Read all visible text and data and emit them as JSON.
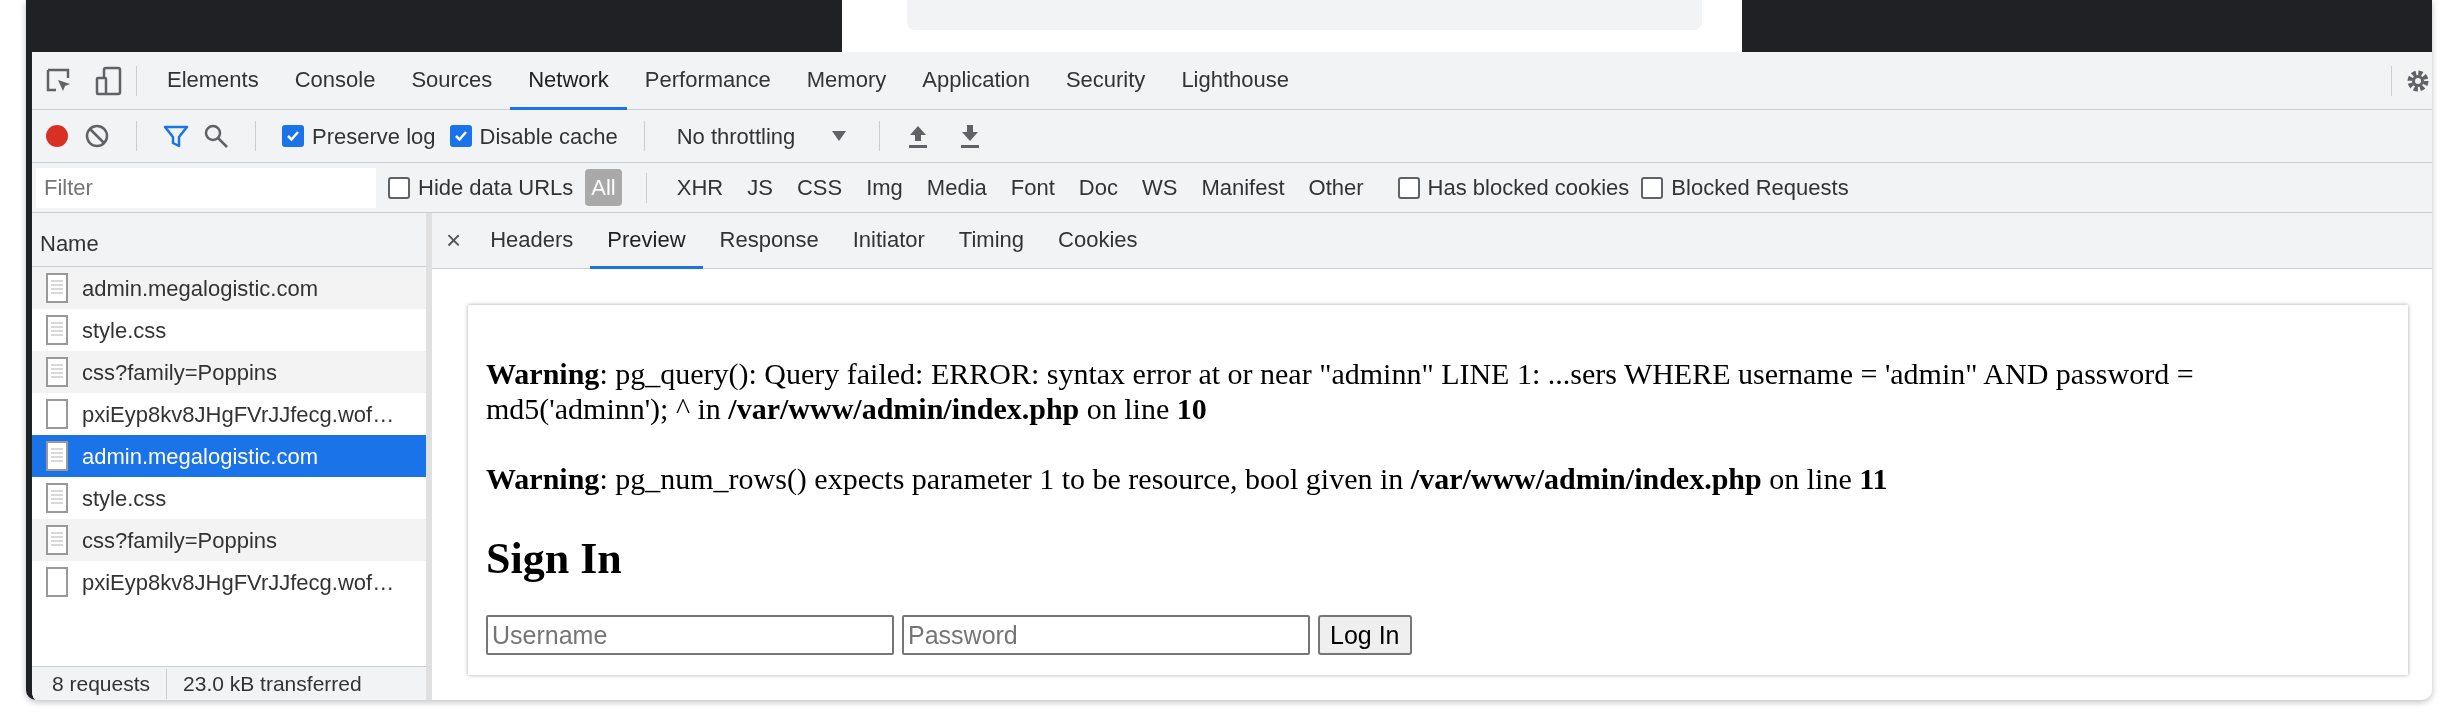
{
  "panel_tabs": [
    {
      "label": "Elements",
      "selected": false
    },
    {
      "label": "Console",
      "selected": false
    },
    {
      "label": "Sources",
      "selected": false
    },
    {
      "label": "Network",
      "selected": true
    },
    {
      "label": "Performance",
      "selected": false
    },
    {
      "label": "Memory",
      "selected": false
    },
    {
      "label": "Application",
      "selected": false
    },
    {
      "label": "Security",
      "selected": false
    },
    {
      "label": "Lighthouse",
      "selected": false
    }
  ],
  "toolbar": {
    "recording": true,
    "checkboxes": [
      {
        "label": "Preserve log",
        "checked": true
      },
      {
        "label": "Disable cache",
        "checked": true
      }
    ],
    "throttling": "No throttling"
  },
  "filter": {
    "placeholder": "Filter",
    "hide_data_urls": {
      "label": "Hide data URLs",
      "checked": false
    },
    "types": [
      {
        "label": "All",
        "selected": true
      },
      {
        "label": "XHR",
        "selected": false
      },
      {
        "label": "JS",
        "selected": false
      },
      {
        "label": "CSS",
        "selected": false
      },
      {
        "label": "Img",
        "selected": false
      },
      {
        "label": "Media",
        "selected": false
      },
      {
        "label": "Font",
        "selected": false
      },
      {
        "label": "Doc",
        "selected": false
      },
      {
        "label": "WS",
        "selected": false
      },
      {
        "label": "Manifest",
        "selected": false
      },
      {
        "label": "Other",
        "selected": false
      }
    ],
    "extra_checkboxes": [
      {
        "label": "Has blocked cookies",
        "checked": false
      },
      {
        "label": "Blocked Requests",
        "checked": false
      }
    ]
  },
  "requests": {
    "header": "Name",
    "items": [
      {
        "name": "admin.megalogistic.com",
        "kind": "document",
        "selected": false
      },
      {
        "name": "style.css",
        "kind": "document",
        "selected": false
      },
      {
        "name": "css?family=Poppins",
        "kind": "document",
        "selected": false
      },
      {
        "name": "pxiEyp8kv8JHgFVrJJfecg.wof…",
        "kind": "blank",
        "selected": false
      },
      {
        "name": "admin.megalogistic.com",
        "kind": "document",
        "selected": true
      },
      {
        "name": "style.css",
        "kind": "document",
        "selected": false
      },
      {
        "name": "css?family=Poppins",
        "kind": "document",
        "selected": false
      },
      {
        "name": "pxiEyp8kv8JHgFVrJJfecg.wof…",
        "kind": "blank",
        "selected": false
      }
    ]
  },
  "status_bar": [
    "8 requests",
    "23.0 kB transferred"
  ],
  "detail": {
    "close": "×",
    "tabs": [
      {
        "label": "Headers",
        "selected": false
      },
      {
        "label": "Preview",
        "selected": true
      },
      {
        "label": "Response",
        "selected": false
      },
      {
        "label": "Initiator",
        "selected": false
      },
      {
        "label": "Timing",
        "selected": false
      },
      {
        "label": "Cookies",
        "selected": false
      }
    ]
  },
  "preview": {
    "messages": [
      "**Warning**: pg_query(): Query failed: ERROR: syntax error at or near \"adminn\" LINE 1: ...sers WHERE username = 'admin\" AND password = md5('adminn'); ^ in **/var/www/admin/index.php** on line **10**",
      "**Warning**: pg_num_rows() expects parameter 1 to be resource, bool given in **/var/www/admin/index.php** on line **11**"
    ],
    "heading": "Sign In",
    "username_placeholder": "Username",
    "password_placeholder": "Password",
    "button": "Log In"
  }
}
